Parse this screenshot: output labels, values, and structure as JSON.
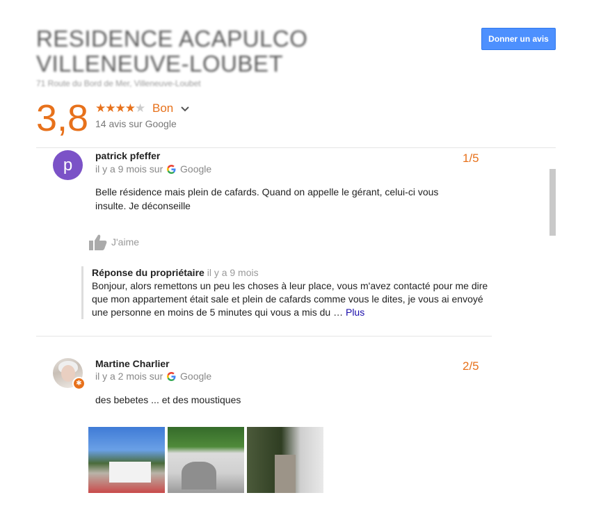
{
  "place": {
    "title_line1": "RESIDENCE ACAPULCO",
    "title_line2": "VILLENEUVE-LOUBET",
    "address": "71 Route du Bord de Mer, Villeneuve-Loubet",
    "write_review_label": "Donner un avis",
    "rating_score": "3,8",
    "rating_stars": 3.8,
    "rating_word": "Bon",
    "review_count_text": "14 avis sur Google"
  },
  "reviews": [
    {
      "avatar_letter": "p",
      "author": "patrick pfeffer",
      "time": "il y a 9 mois sur",
      "source": "Google",
      "score": "1/5",
      "text": "Belle résidence mais plein de cafards. Quand on appelle le gérant, celui-ci vous insulte. Je déconseille",
      "like_label": "J'aime",
      "owner_reply": {
        "heading": "Réponse du propriétaire",
        "time": "il y a 9 mois",
        "text": "Bonjour, alors remettons un peu les choses à leur place, vous m'avez contacté pour me dire que mon appartement était sale et plein de cafards comme vous le dites, je vous ai envoyé une personne en moins de 5 minutes qui vous a mis du … ",
        "more_label": "Plus"
      }
    },
    {
      "author": "Martine Charlier",
      "time": "il y a 2 mois sur",
      "source": "Google",
      "score": "2/5",
      "text": "des bebetes ... et des moustiques",
      "photo_count": 3
    }
  ],
  "colors": {
    "accent_orange": "#e7711b",
    "button_blue": "#4d90fe",
    "avatar_purple": "#7b52c7",
    "link_blue": "#1a0dab"
  }
}
